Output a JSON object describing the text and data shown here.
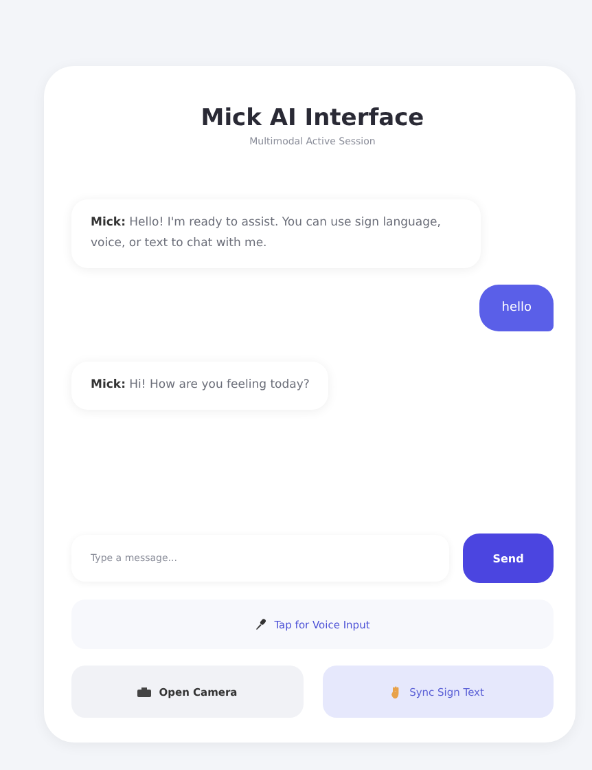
{
  "header": {
    "title": "Mick AI Interface",
    "subtitle": "Multimodal Active Session"
  },
  "messages": [
    {
      "kind": "bot",
      "text": "**Mick:** Hello! I'm ready to assist. You can use sign language, voice, or text to chat with me."
    },
    {
      "kind": "user",
      "text": "hello"
    },
    {
      "kind": "bot",
      "text": "**Mick:** Hi! How are you feeling today?"
    }
  ],
  "composer": {
    "placeholder": "Type a message...",
    "send": "Send"
  },
  "voice_button": "Tap for Voice Input",
  "actions": [
    {
      "kind": "camera",
      "label": "Open Camera"
    },
    {
      "kind": "sync",
      "label": "Sync Sign Text"
    }
  ]
}
